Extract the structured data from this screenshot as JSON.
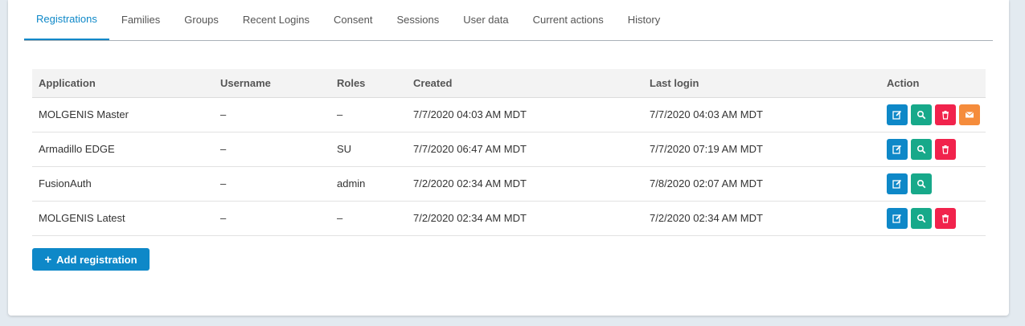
{
  "tabs": [
    {
      "label": "Registrations",
      "active": true
    },
    {
      "label": "Families"
    },
    {
      "label": "Groups"
    },
    {
      "label": "Recent Logins"
    },
    {
      "label": "Consent"
    },
    {
      "label": "Sessions"
    },
    {
      "label": "User data"
    },
    {
      "label": "Current actions"
    },
    {
      "label": "History"
    }
  ],
  "table": {
    "headers": [
      "Application",
      "Username",
      "Roles",
      "Created",
      "Last login",
      "Action"
    ],
    "rows": [
      {
        "application": "MOLGENIS Master",
        "username": "–",
        "roles": "–",
        "created": "7/7/2020 04:03 AM MDT",
        "last_login": "7/7/2020 04:03 AM MDT",
        "actions": [
          "edit-icon",
          "view-icon",
          "delete-icon",
          "email-icon"
        ]
      },
      {
        "application": "Armadillo EDGE",
        "username": "–",
        "roles": "SU",
        "created": "7/7/2020 06:47 AM MDT",
        "last_login": "7/7/2020 07:19 AM MDT",
        "actions": [
          "edit-icon",
          "view-icon",
          "delete-icon"
        ]
      },
      {
        "application": "FusionAuth",
        "username": "–",
        "roles": "admin",
        "created": "7/2/2020 02:34 AM MDT",
        "last_login": "7/8/2020 02:07 AM MDT",
        "actions": [
          "edit-icon",
          "view-icon"
        ]
      },
      {
        "application": "MOLGENIS Latest",
        "username": "–",
        "roles": "–",
        "created": "7/2/2020 02:34 AM MDT",
        "last_login": "7/2/2020 02:34 AM MDT",
        "actions": [
          "edit-icon",
          "view-icon",
          "delete-icon"
        ]
      }
    ]
  },
  "add_button": {
    "label": "Add registration",
    "icon": "plus-icon"
  },
  "colors": {
    "accent": "#0e88c8",
    "edit": "#0e88c8",
    "view": "#17a98a",
    "delete": "#f1234c",
    "email": "#f58c3c"
  }
}
